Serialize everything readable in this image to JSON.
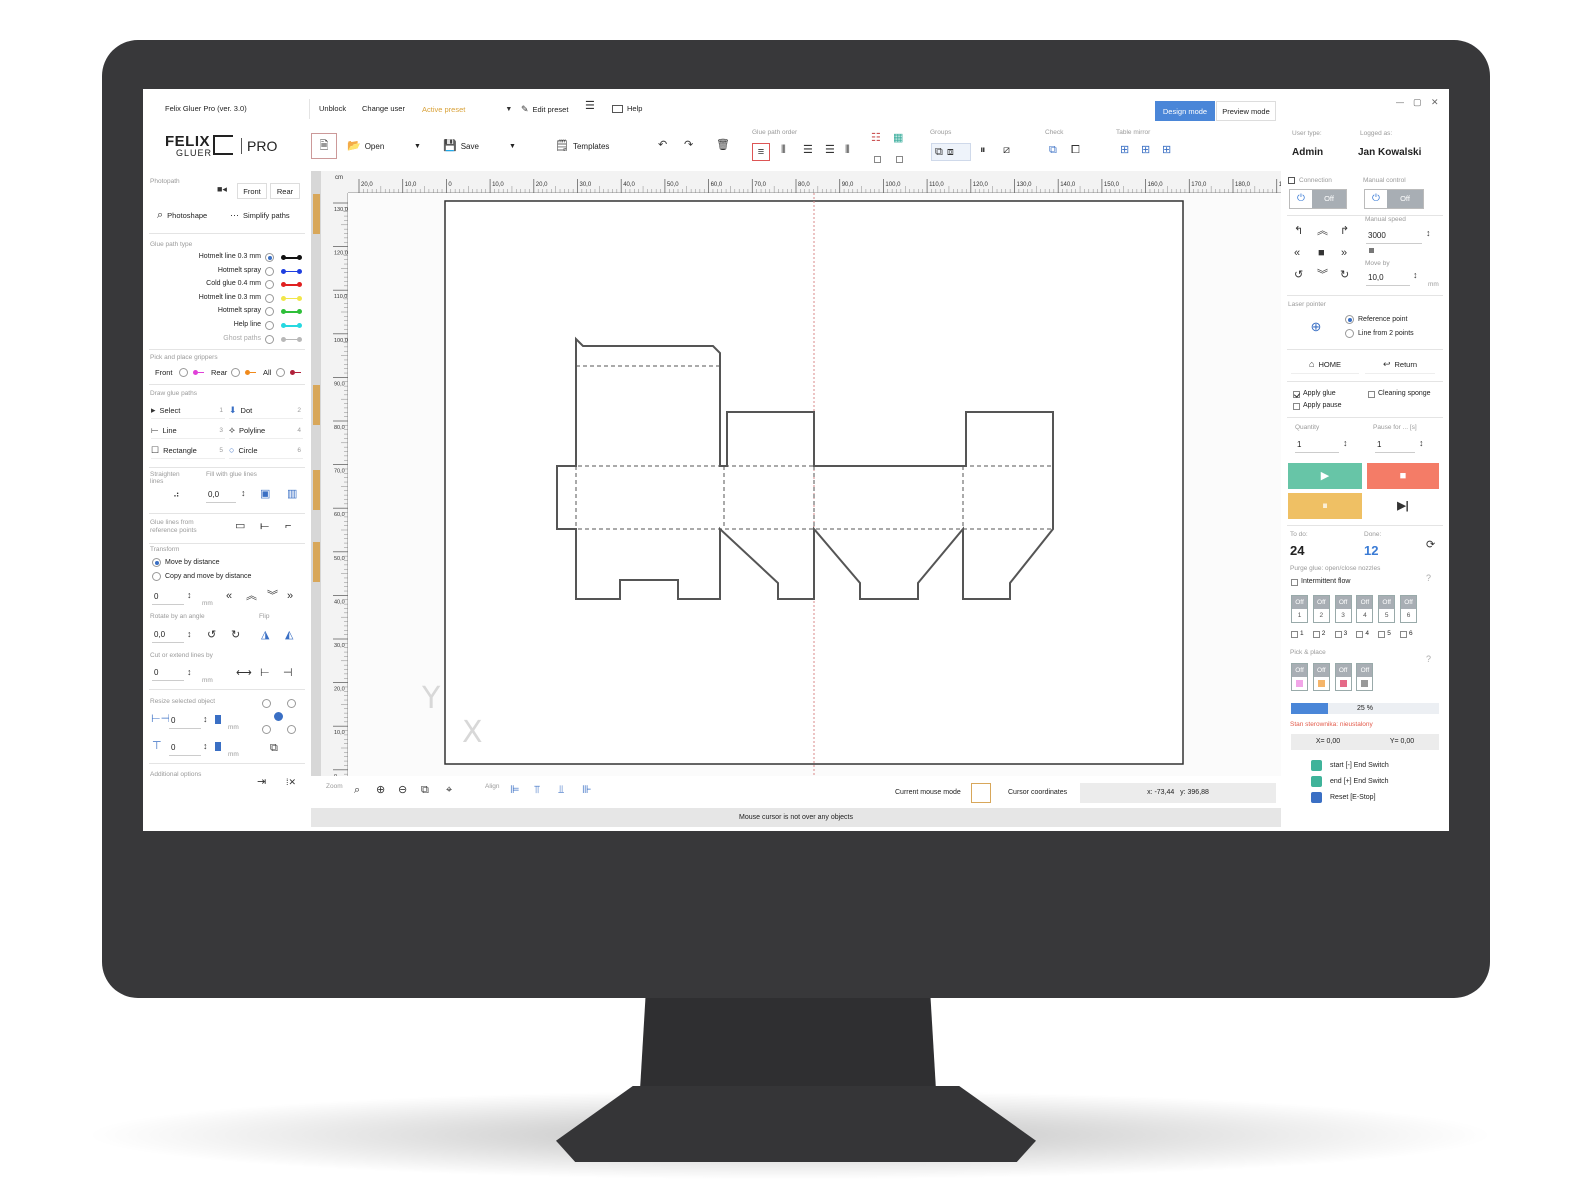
{
  "app": {
    "title": "Felix Gluer Pro (ver. 3.0)"
  },
  "menu": {
    "unblock": "Unblock",
    "change_user": "Change user",
    "active_preset": "Active preset",
    "edit_preset": "Edit preset",
    "help": "Help",
    "design_mode": "Design mode",
    "preview_mode": "Preview mode"
  },
  "logo": {
    "felix": "FELIX",
    "gluer": "GLUER",
    "pro": "PRO"
  },
  "toolbar": {
    "open": "Open",
    "save": "Save",
    "templates": "Templates",
    "glue_path_order": "Glue path order",
    "groups": "Groups",
    "check": "Check",
    "table_mirror": "Table mirror"
  },
  "user": {
    "user_type_label": "User type:",
    "user_type": "Admin",
    "logged_as_label": "Logged as:",
    "logged_as": "Jan Kowalski"
  },
  "left": {
    "photopath": "Photopath",
    "front": "Front",
    "rear": "Rear",
    "photoshape": "Photoshape",
    "simplify": "Simplify paths",
    "glue_path_type": "Glue path type",
    "glue_types": [
      {
        "label": "Hotmelt line 0.3 mm",
        "color": "#111111"
      },
      {
        "label": "Hotmelt spray",
        "color": "#1f3fe0"
      },
      {
        "label": "Cold glue 0.4 mm",
        "color": "#e02020"
      },
      {
        "label": "Hotmelt line 0.3 mm",
        "color": "#f2e64a"
      },
      {
        "label": "Hotmelt spray",
        "color": "#2fbf3a"
      },
      {
        "label": "Help line",
        "color": "#26d8e0"
      },
      {
        "label": "Ghost paths",
        "color": "#b8b8b8"
      }
    ],
    "pick_place_grippers": "Pick and place grippers",
    "pp_front": "Front",
    "pp_rear": "Rear",
    "pp_all": "All",
    "draw_glue_paths": "Draw glue paths",
    "tools": [
      {
        "label": "Select",
        "key": "1"
      },
      {
        "label": "Dot",
        "key": "2"
      },
      {
        "label": "Line",
        "key": "3"
      },
      {
        "label": "Polyline",
        "key": "4"
      },
      {
        "label": "Rectangle",
        "key": "5"
      },
      {
        "label": "Circle",
        "key": "6"
      }
    ],
    "straighten": "Straighten lines",
    "fill_with": "Fill with glue lines",
    "fill_value": "0,0",
    "glue_from_ref": "Glue lines from reference points",
    "transform": "Transform",
    "move_by_distance": "Move by distance",
    "copy_and_move": "Copy and move by distance",
    "move_value": "0",
    "mm": "mm",
    "rotate_label": "Rotate by an angle",
    "flip_label": "Flip",
    "rotate_value": "0,0",
    "cut_extend": "Cut or extend lines by",
    "cut_value": "0",
    "resize": "Resize selected object",
    "resize_w": "0",
    "resize_h": "0",
    "additional": "Additional options"
  },
  "ruler": {
    "unit": "cm",
    "x_ticks": [
      "20,0",
      "10,0",
      "0",
      "10,0",
      "20,0",
      "30,0",
      "40,0",
      "50,0",
      "60,0",
      "70,0",
      "80,0",
      "90,0",
      "100,0",
      "110,0",
      "120,0",
      "130,0",
      "140,0",
      "150,0",
      "160,0",
      "170,0",
      "180,0",
      "19"
    ],
    "y_ticks": [
      "130,0",
      "120,0",
      "110,0",
      "100,0",
      "90,0",
      "80,0",
      "70,0",
      "60,0",
      "50,0",
      "40,0",
      "30,0",
      "20,0",
      "10,0",
      "0"
    ]
  },
  "canvas": {
    "axis_y": "Y",
    "axis_x": "X"
  },
  "bottom": {
    "zoom": "Zoom",
    "align": "Align",
    "current_mouse_mode": "Current mouse mode",
    "cursor_coordinates": "Cursor coordinates",
    "coords": "x: -73,44   y: 396,88",
    "status": "Mouse cursor is not over any objects"
  },
  "right": {
    "connection": "Connection",
    "manual_control": "Manual control",
    "off": "Off",
    "manual_speed": "Manual speed",
    "speed_value": "3000",
    "move_by": "Move by",
    "move_by_value": "10,0",
    "mm": "mm",
    "laser_pointer": "Laser pointer",
    "reference_point": "Reference point",
    "line_from_2": "Line from 2 points",
    "home": "HOME",
    "return": "Return",
    "apply_glue": "Apply glue",
    "apply_pause": "Apply pause",
    "cleaning_sponge": "Cleaning sponge",
    "quantity": "Quantity",
    "quantity_value": "1",
    "pause_for": "Pause for ... [s]",
    "pause_value": "1",
    "todo_label": "To do:",
    "todo": "24",
    "done_label": "Done:",
    "done": "12",
    "purge": "Purge glue: open/close nozzles",
    "intermittent": "Intermittent flow",
    "nozzles": [
      "1",
      "2",
      "3",
      "4",
      "5",
      "6"
    ],
    "pick_place": "Pick & place",
    "progress_label": "25 %",
    "progress_value": 0.25,
    "status_error": "Stan sterownika: nieustalony",
    "x_coord": "X= 0,00",
    "y_coord": "Y= 0,00",
    "switches": [
      {
        "label": "start [-] End Switch",
        "color": "#3fb39a"
      },
      {
        "label": "end [+] End Switch",
        "color": "#3fb39a"
      },
      {
        "label": "Reset [E-Stop]",
        "color": "#3a6fc4"
      }
    ],
    "colors": {
      "start": "#67c5a7",
      "stop": "#f47c67",
      "pause": "#efc064",
      "accent": "#3a7bd5"
    }
  }
}
